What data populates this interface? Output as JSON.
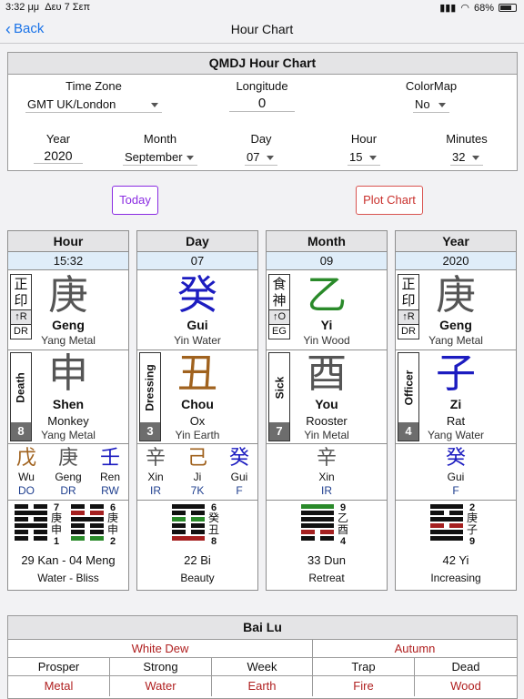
{
  "status": {
    "time": "3:32 μμ",
    "date": "Δευ 7 Σεπ",
    "battery": "68%"
  },
  "nav": {
    "back": "Back",
    "title": "Hour Chart"
  },
  "form": {
    "title": "QMDJ Hour Chart",
    "time_zone_label": "Time Zone",
    "time_zone": "GMT UK/London",
    "longitude_label": "Longitude",
    "longitude": "0",
    "colormap_label": "ColorMap",
    "colormap": "No",
    "year_label": "Year",
    "year": "2020",
    "month_label": "Month",
    "month": "September",
    "day_label": "Day",
    "day": "07",
    "hour_label": "Hour",
    "hour": "15",
    "minutes_label": "Minutes",
    "minutes": "32"
  },
  "buttons": {
    "today": "Today",
    "plot": "Plot Chart"
  },
  "colors": {
    "green": "#2a8a2a",
    "blue": "#1c1cc0",
    "brown": "#a0621e",
    "gray": "#555555",
    "red": "#a52020",
    "black": "#111111"
  },
  "pillars": [
    {
      "header": "Hour",
      "value": "15:32",
      "stem": {
        "char": "庚",
        "name": "Geng",
        "desc": "Yang Metal",
        "color": "gray"
      },
      "god": {
        "chars": [
          "正",
          "印"
        ],
        "mark": "↑R",
        "code": "DR"
      },
      "star": {
        "label": "Death",
        "num": "8"
      },
      "branch": {
        "char": "申",
        "name": "Shen",
        "animal": "Monkey",
        "desc": "Yang Metal",
        "color": "gray"
      },
      "hidden": [
        {
          "char": "戊",
          "name": "Wu",
          "code": "DO",
          "color": "brown"
        },
        {
          "char": "庚",
          "name": "Geng",
          "code": "DR",
          "color": "gray"
        },
        {
          "char": "壬",
          "name": "Ren",
          "code": "RW",
          "color": "blue"
        }
      ],
      "hexagrams": [
        {
          "top": "7",
          "chars": [
            "庚",
            "申"
          ],
          "bottom": "1",
          "lines": [
            [
              "n",
              "black"
            ],
            [
              "y",
              "black"
            ],
            [
              "n",
              "black"
            ],
            [
              "y",
              "black"
            ],
            [
              "n",
              "black"
            ],
            [
              "n",
              "black"
            ]
          ]
        },
        {
          "top": "6",
          "chars": [
            "庚",
            "申"
          ],
          "bottom": "2",
          "lines": [
            [
              "n",
              "black"
            ],
            [
              "n",
              "red"
            ],
            [
              "y",
              "black"
            ],
            [
              "n",
              "black"
            ],
            [
              "n",
              "black"
            ],
            [
              "n",
              "green"
            ]
          ]
        }
      ],
      "hex_name": "29 Kan - 04 Meng",
      "hex_meaning": "Water - Bliss"
    },
    {
      "header": "Day",
      "value": "07",
      "stem": {
        "char": "癸",
        "name": "Gui",
        "desc": "Yin Water",
        "color": "blue"
      },
      "star": {
        "label": "Dressing",
        "num": "3"
      },
      "branch": {
        "char": "丑",
        "name": "Chou",
        "animal": "Ox",
        "desc": "Yin Earth",
        "color": "brown"
      },
      "hidden": [
        {
          "char": "辛",
          "name": "Xin",
          "code": "IR",
          "color": "gray"
        },
        {
          "char": "己",
          "name": "Ji",
          "code": "7K",
          "color": "brown"
        },
        {
          "char": "癸",
          "name": "Gui",
          "code": "F",
          "color": "blue"
        }
      ],
      "hexagrams": [
        {
          "top": "6",
          "chars": [
            "癸",
            "丑"
          ],
          "bottom": "8",
          "lines": [
            [
              "y",
              "black"
            ],
            [
              "n",
              "black"
            ],
            [
              "n",
              "green"
            ],
            [
              "n",
              "black"
            ],
            [
              "n",
              "black"
            ],
            [
              "y",
              "red"
            ]
          ]
        }
      ],
      "hex_name": "22 Bi",
      "hex_meaning": "Beauty"
    },
    {
      "header": "Month",
      "value": "09",
      "stem": {
        "char": "乙",
        "name": "Yi",
        "desc": "Yin Wood",
        "color": "green"
      },
      "god": {
        "chars": [
          "食",
          "神"
        ],
        "mark": "↑O",
        "code": "EG"
      },
      "star": {
        "label": "Sick",
        "num": "7"
      },
      "branch": {
        "char": "酉",
        "name": "You",
        "animal": "Rooster",
        "desc": "Yin Metal",
        "color": "gray"
      },
      "hidden": [
        {
          "char": "辛",
          "name": "Xin",
          "code": "IR",
          "color": "gray"
        }
      ],
      "hexagrams": [
        {
          "top": "9",
          "chars": [
            "乙",
            "酉"
          ],
          "bottom": "4",
          "lines": [
            [
              "y",
              "green"
            ],
            [
              "y",
              "black"
            ],
            [
              "y",
              "black"
            ],
            [
              "y",
              "black"
            ],
            [
              "n",
              "red"
            ],
            [
              "n",
              "black"
            ]
          ]
        }
      ],
      "hex_name": "33 Dun",
      "hex_meaning": "Retreat"
    },
    {
      "header": "Year",
      "value": "2020",
      "stem": {
        "char": "庚",
        "name": "Geng",
        "desc": "Yang Metal",
        "color": "gray"
      },
      "god": {
        "chars": [
          "正",
          "印"
        ],
        "mark": "↑R",
        "code": "DR"
      },
      "star": {
        "label": "Officer",
        "num": "4"
      },
      "branch": {
        "char": "子",
        "name": "Zi",
        "animal": "Rat",
        "desc": "Yang Water",
        "color": "blue"
      },
      "hidden": [
        {
          "char": "癸",
          "name": "Gui",
          "code": "F",
          "color": "blue"
        }
      ],
      "hexagrams": [
        {
          "top": "2",
          "chars": [
            "庚",
            "子"
          ],
          "bottom": "9",
          "lines": [
            [
              "y",
              "black"
            ],
            [
              "n",
              "black"
            ],
            [
              "y",
              "black"
            ],
            [
              "n",
              "red"
            ],
            [
              "y",
              "black"
            ],
            [
              "y",
              "black"
            ]
          ]
        }
      ],
      "hex_name": "42 Yi",
      "hex_meaning": "Increasing"
    }
  ],
  "bottom": {
    "title": "Bai Lu",
    "terms": [
      "White Dew",
      "Autumn"
    ],
    "headers": [
      "Prosper",
      "Strong",
      "Week",
      "Trap",
      "Dead"
    ],
    "values": [
      "Metal",
      "Water",
      "Earth",
      "Fire",
      "Wood"
    ]
  }
}
